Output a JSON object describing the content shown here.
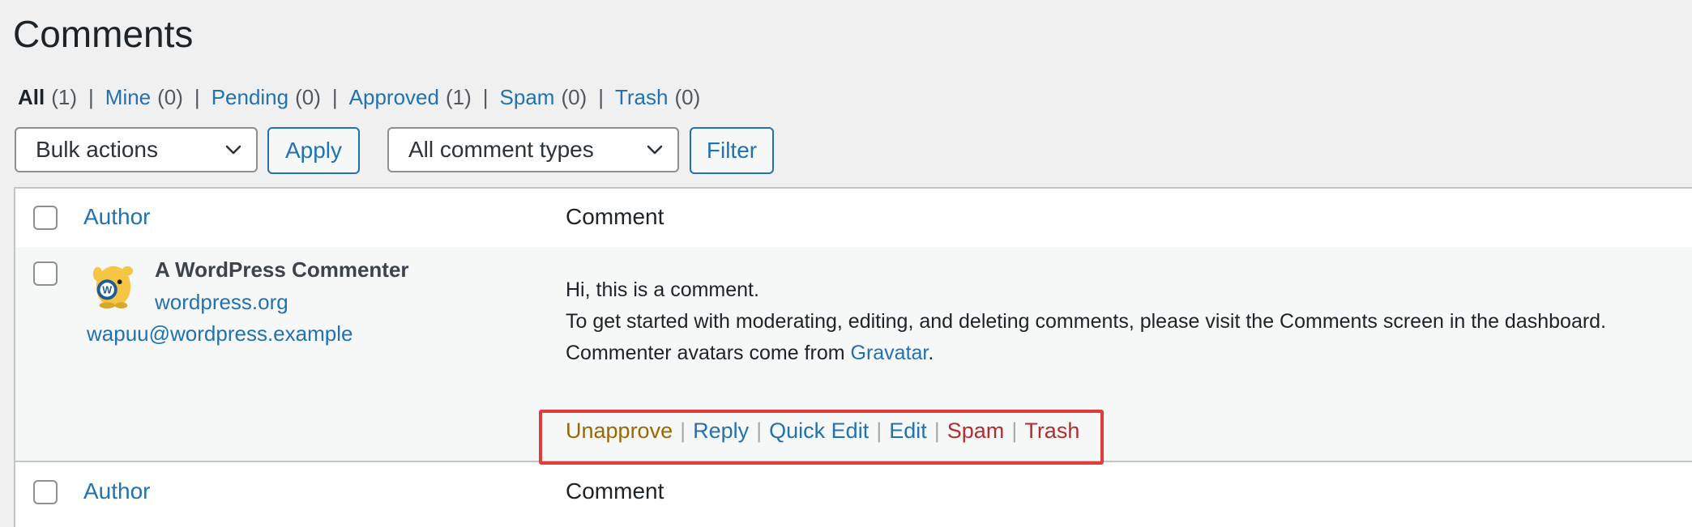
{
  "page": {
    "title": "Comments"
  },
  "filters": [
    {
      "label": "All",
      "count": "(1)",
      "current": true
    },
    {
      "label": "Mine",
      "count": "(0)"
    },
    {
      "label": "Pending",
      "count": "(0)"
    },
    {
      "label": "Approved",
      "count": "(1)"
    },
    {
      "label": "Spam",
      "count": "(0)"
    },
    {
      "label": "Trash",
      "count": "(0)"
    }
  ],
  "toolbar": {
    "bulk_actions": "Bulk actions",
    "apply": "Apply",
    "comment_types": "All comment types",
    "filter": "Filter"
  },
  "table": {
    "header": {
      "author": "Author",
      "comment": "Comment"
    },
    "footer": {
      "author": "Author",
      "comment": "Comment"
    },
    "row": {
      "author_name": "A WordPress Commenter",
      "author_url": "wordpress.org",
      "author_email": "wapuu@wordpress.example",
      "avatar_icon": "wapuu-avatar-icon",
      "comment_lines": {
        "line1": "Hi, this is a comment.",
        "line2": "To get started with moderating, editing, and deleting comments, please visit the Comments screen in the dashboard.",
        "line3_prefix": "Commenter avatars come from ",
        "line3_link": "Gravatar",
        "line3_suffix": "."
      },
      "actions": {
        "unapprove": "Unapprove",
        "reply": "Reply",
        "quick_edit": "Quick Edit",
        "edit": "Edit",
        "spam": "Spam",
        "trash": "Trash"
      }
    }
  },
  "colors": {
    "link": "#2271b1",
    "unapprove": "#996800",
    "delete": "#b32d2e",
    "highlight": "#e03c3c"
  }
}
